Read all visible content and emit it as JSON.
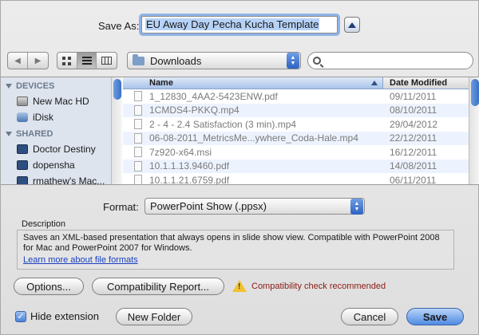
{
  "save": {
    "label": "Save As:",
    "filename": "EU Away Day Pecha Kucha Template"
  },
  "toolbar": {
    "location": "Downloads",
    "search_placeholder": ""
  },
  "sidebar": {
    "devices_header": "DEVICES",
    "devices": [
      "New Mac HD",
      "iDisk"
    ],
    "shared_header": "SHARED",
    "shared": [
      "Doctor Destiny",
      "dopensha",
      "rmathew's Mac..."
    ]
  },
  "filelist": {
    "col_name": "Name",
    "col_date": "Date Modified",
    "rows": [
      {
        "name": "1_12830_4AA2-5423ENW.pdf",
        "date": "09/11/2011"
      },
      {
        "name": "1CMDS4-PKKQ.mp4",
        "date": "08/10/2011"
      },
      {
        "name": "2 - 4 - 2.4 Satisfaction (3 min).mp4",
        "date": "29/04/2012"
      },
      {
        "name": "06-08-2011_MetricsMe...ywhere_Coda-Hale.mp4",
        "date": "22/12/2011"
      },
      {
        "name": "7z920-x64.msi",
        "date": "16/12/2011"
      },
      {
        "name": "10.1.1.13.9460.pdf",
        "date": "14/08/2011"
      },
      {
        "name": "10.1.1.21.6759.pdf",
        "date": "06/11/2011"
      }
    ]
  },
  "format": {
    "label": "Format:",
    "value": "PowerPoint Show (.ppsx)"
  },
  "description": {
    "title": "Description",
    "text": "Saves an XML-based presentation that always opens in slide show view. Compatible with PowerPoint 2008 for Mac and PowerPoint 2007 for Windows.",
    "link": "Learn more about file formats"
  },
  "buttons": {
    "options": "Options...",
    "compat_report": "Compatibility Report...",
    "new_folder": "New Folder",
    "cancel": "Cancel",
    "save": "Save"
  },
  "warning": "Compatibility check recommended",
  "hide_extension": {
    "label": "Hide extension",
    "checked": true
  }
}
